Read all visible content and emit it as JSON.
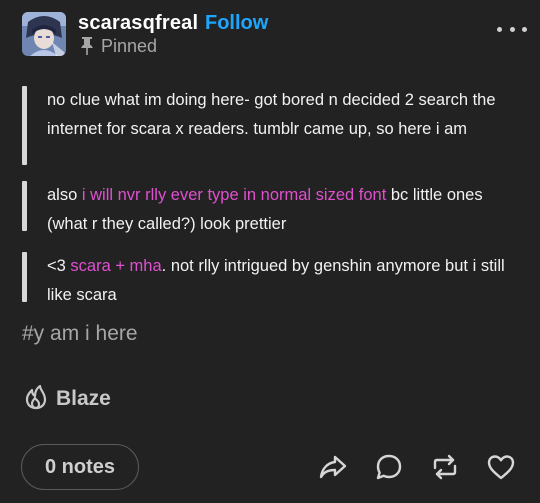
{
  "post": {
    "username": "scarasqfreal",
    "follow_label": "Follow",
    "pinned_label": "Pinned",
    "paragraphs": [
      {
        "before": "no clue what im doing here- got bored n decided 2 search the internet for scara x readers. tumblr came up, so here i am",
        "highlight": "",
        "after": ""
      },
      {
        "before": "also ",
        "highlight": "i will nvr rlly ever type in normal sized font",
        "after": " bc little ones (what r they called?) look prettier"
      },
      {
        "before": "<3 ",
        "highlight": "scara + mha",
        "after": ". not rlly intrigued by genshin anymore but i still like scara"
      }
    ],
    "tag": "#y am i here",
    "blaze_label": "Blaze",
    "notes_label": "0 notes"
  },
  "colors": {
    "background": "#222222",
    "follow": "#1ea6ff",
    "highlight_text": "#e04fd0",
    "muted": "#a6a6a6"
  },
  "icons": [
    "avatar",
    "pin-icon",
    "more-icon",
    "flame-icon",
    "share-icon",
    "reply-icon",
    "reblog-icon",
    "heart-icon"
  ]
}
